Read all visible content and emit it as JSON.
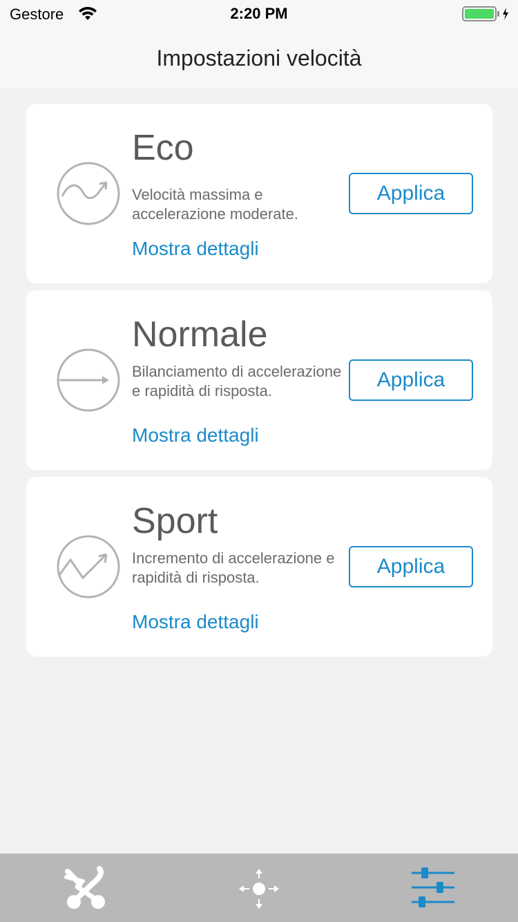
{
  "status_bar": {
    "carrier": "Gestore",
    "time": "2:20 PM",
    "wifi_icon": "wifi-icon",
    "battery_icon": "battery-charging-icon",
    "battery_color": "#4cd964"
  },
  "nav": {
    "title": "Impostazioni velocità"
  },
  "modes": [
    {
      "title": "Eco",
      "description": "Velocità massima e accelerazione moderate.",
      "details_link": "Mostra dettagli",
      "apply_label": "Applica",
      "icon": "eco-wave-curve-icon"
    },
    {
      "title": "Normale",
      "description": "Bilanciamento di accelerazione e rapidità di risposta.",
      "details_link": "Mostra dettagli",
      "apply_label": "Applica",
      "icon": "normal-straight-arrow-icon"
    },
    {
      "title": "Sport",
      "description": "Incremento di accelerazione e rapidità di risposta.",
      "details_link": "Mostra dettagli",
      "apply_label": "Applica",
      "icon": "sport-zigzag-arrow-icon"
    }
  ],
  "tab_bar": {
    "tabs": [
      {
        "icon": "stroller-icon",
        "active": false
      },
      {
        "icon": "move-directions-icon",
        "active": false
      },
      {
        "icon": "settings-sliders-icon",
        "active": true
      }
    ],
    "active_color": "#1b8ac9",
    "inactive_color": "#ffffff"
  },
  "colors": {
    "accent": "#1b8ac9",
    "background": "#f2f2f2",
    "card": "#ffffff"
  }
}
